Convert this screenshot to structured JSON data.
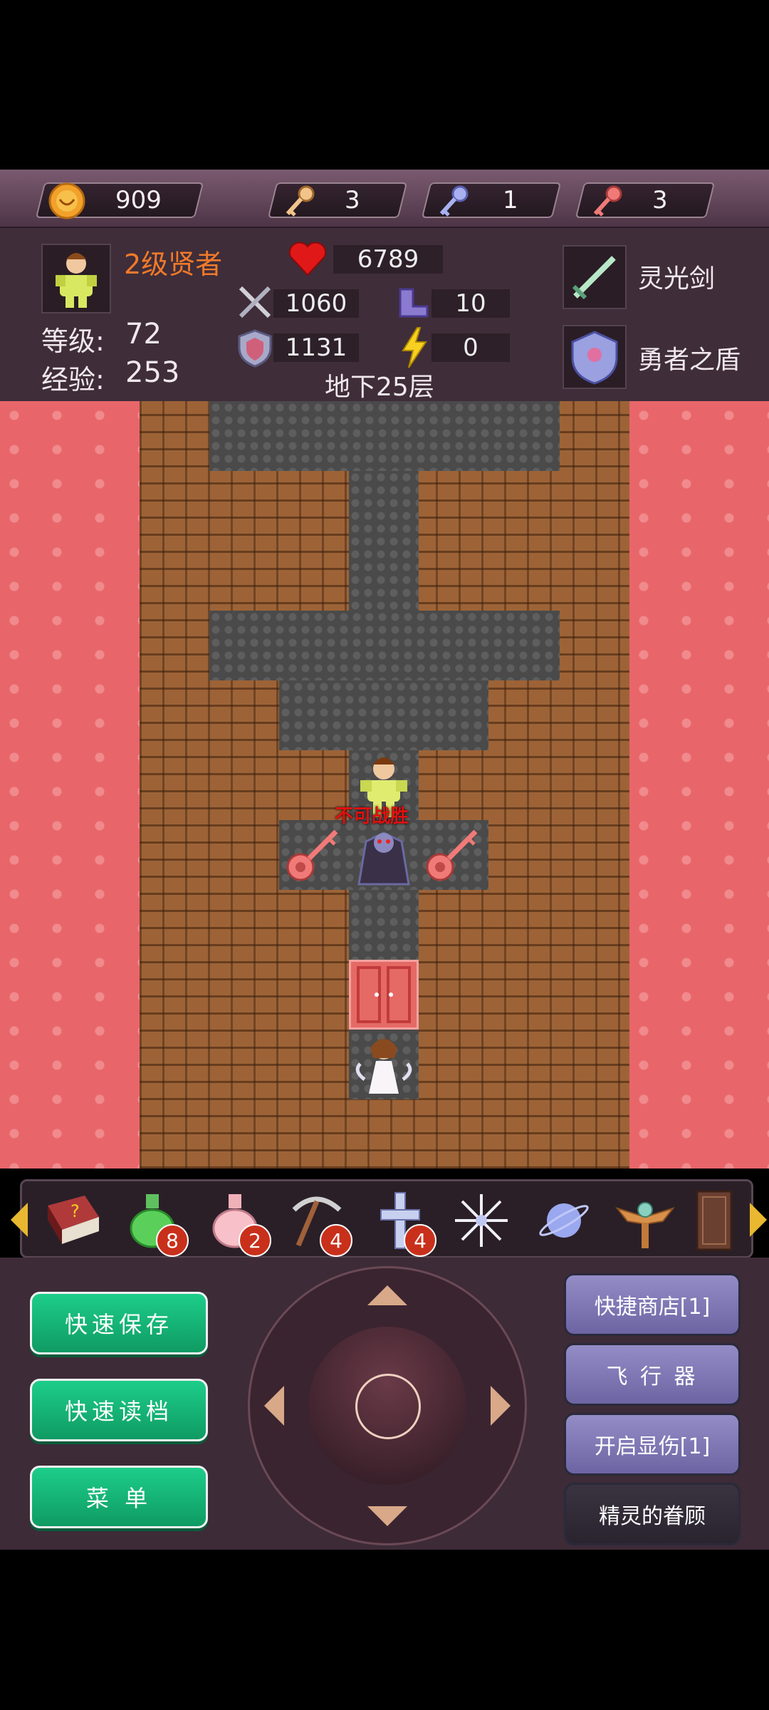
{
  "resources": {
    "gold": "909",
    "yellow_keys": "3",
    "blue_keys": "1",
    "red_keys": "3"
  },
  "hero": {
    "title": "2级贤者",
    "level_label": "等级:",
    "level": "72",
    "exp_label": "经验:",
    "exp": "253"
  },
  "stats": {
    "hp": "6789",
    "attack": "1060",
    "agility": "10",
    "defense": "1131",
    "magic": "0"
  },
  "equipment": {
    "weapon": "灵光剑",
    "shield": "勇者之盾"
  },
  "floor_name": "地下25层",
  "map": {
    "monster_tag": "不可战胜"
  },
  "items": [
    {
      "name": "monster-book-icon",
      "count": ""
    },
    {
      "name": "green-potion-icon",
      "count": "8"
    },
    {
      "name": "pink-potion-icon",
      "count": "2"
    },
    {
      "name": "pickaxe-icon",
      "count": "4"
    },
    {
      "name": "cross-icon",
      "count": "4"
    },
    {
      "name": "snowflake-icon",
      "count": ""
    },
    {
      "name": "orb-icon",
      "count": ""
    },
    {
      "name": "winged-staff-icon",
      "count": ""
    },
    {
      "name": "door-icon",
      "count": ""
    }
  ],
  "buttons": {
    "quick_save": "快速保存",
    "quick_load": "快速读档",
    "menu": "菜 单",
    "shop": "快捷商店[1]",
    "fly": "飞 行 器",
    "damage": "开启显伤[1]",
    "fairy": "精灵的眷顾"
  },
  "colors": {
    "title_orange": "#f07a2a",
    "lava": "#e8666a",
    "green_button": "#14b474",
    "purple_button": "#8078b8"
  }
}
